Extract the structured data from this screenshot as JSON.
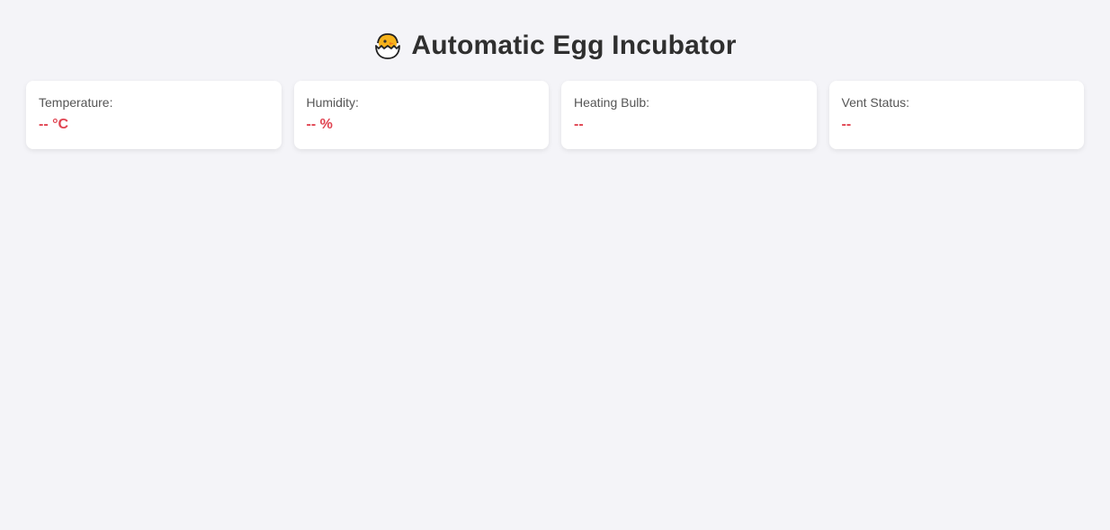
{
  "header": {
    "title": "Automatic Egg Incubator",
    "icon": "hatching-chick-icon"
  },
  "colors": {
    "background": "#f4f4f8",
    "card_bg": "#ffffff",
    "value_color": "#e04451",
    "label_color": "#555555"
  },
  "cards": [
    {
      "label": "Temperature:",
      "value": "-- °C"
    },
    {
      "label": "Humidity:",
      "value": "-- %"
    },
    {
      "label": "Heating Bulb:",
      "value": "--"
    },
    {
      "label": "Vent Status:",
      "value": "--"
    }
  ]
}
